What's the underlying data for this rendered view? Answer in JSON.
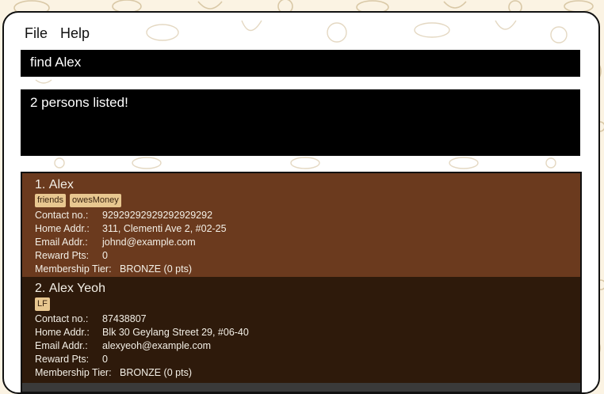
{
  "menu": {
    "file": "File",
    "help": "Help"
  },
  "command": {
    "value": "find Alex"
  },
  "result": {
    "text": "2 persons listed!"
  },
  "persons": [
    {
      "index": "1.",
      "name": "Alex",
      "tags": [
        "friends",
        "owesMoney"
      ],
      "contact_label": "Contact no.:",
      "contact": "92929292929292929292",
      "address_label": "Home Addr.:",
      "address": "311, Clementi Ave 2, #02-25",
      "email_label": "Email Addr.:",
      "email": "johnd@example.com",
      "reward_label": "Reward Pts:",
      "reward": "0",
      "tier_label": "Membership Tier:",
      "tier": "BRONZE (0 pts)"
    },
    {
      "index": "2.",
      "name": "Alex Yeoh",
      "tags": [
        "LF"
      ],
      "contact_label": "Contact no.:",
      "contact": "87438807",
      "address_label": "Home Addr.:",
      "address": "Blk 30 Geylang Street 29, #06-40",
      "email_label": "Email Addr.:",
      "email": "alexyeoh@example.com",
      "reward_label": "Reward Pts:",
      "reward": "0",
      "tier_label": "Membership Tier:",
      "tier": "BRONZE (0 pts)"
    }
  ],
  "colors": {
    "card_selected": "#6b3a1e",
    "card_normal": "#2e1a0b",
    "tag": "#e8c790",
    "command_bg": "#000000"
  }
}
